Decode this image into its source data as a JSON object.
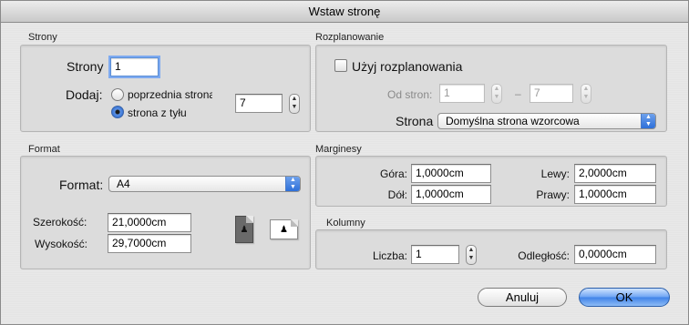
{
  "window": {
    "title": "Wstaw stronę"
  },
  "strony": {
    "section": "Strony",
    "count_label": "Strony",
    "count_value": "1",
    "add_label": "Dodaj:",
    "option_before": "poprzednia strona",
    "option_after": "strona z tyłu",
    "target_page": "7",
    "selected_option": "strona z tyłu"
  },
  "layout": {
    "section": "Rozplanowanie",
    "use_label": "Użyj rozplanowania",
    "use_checked": false,
    "range_label": "Od stron:",
    "range_from": "1",
    "range_dash": "–",
    "range_to": "7",
    "page_label": "Strona",
    "page_value": "Domyślna strona wzorcowa"
  },
  "format": {
    "section": "Format",
    "format_label": "Format:",
    "format_value": "A4",
    "width_label": "Szerokość:",
    "width_value": "21,0000cm",
    "height_label": "Wysokość:",
    "height_value": "29,7000cm",
    "orientation": "portrait"
  },
  "margins": {
    "section": "Marginesy",
    "top_label": "Góra:",
    "top_value": "1,0000cm",
    "bottom_label": "Dół:",
    "bottom_value": "1,0000cm",
    "left_label": "Lewy:",
    "left_value": "2,0000cm",
    "right_label": "Prawy:",
    "right_value": "1,0000cm"
  },
  "columns": {
    "section": "Kolumny",
    "count_label": "Liczba:",
    "count_value": "1",
    "gap_label": "Odległość:",
    "gap_value": "0,0000cm"
  },
  "buttons": {
    "cancel": "Anuluj",
    "ok": "OK"
  },
  "icons": {
    "stepper": "stepper-arrows",
    "popup": "popup-arrows",
    "portrait": "portrait-page-icon",
    "landscape": "landscape-page-icon"
  }
}
